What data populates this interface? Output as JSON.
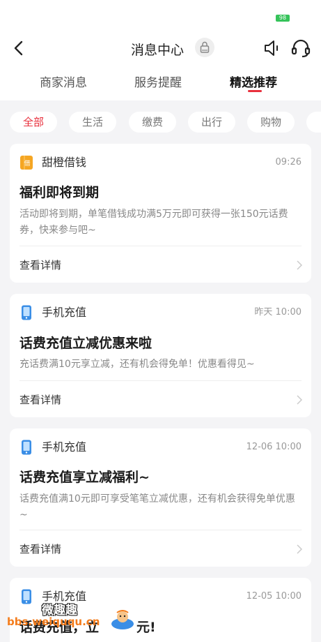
{
  "status_bar": {
    "battery": "98"
  },
  "header": {
    "title": "消息中心"
  },
  "tabs": [
    {
      "label": "商家消息"
    },
    {
      "label": "服务提醒"
    },
    {
      "label": "精选推荐"
    }
  ],
  "filters": [
    {
      "label": "全部"
    },
    {
      "label": "生活"
    },
    {
      "label": "缴费"
    },
    {
      "label": "出行"
    },
    {
      "label": "购物"
    }
  ],
  "messages": [
    {
      "source": "甜橙借钱",
      "icon_glyph": "借",
      "time": "09:26",
      "title": "福利即将到期",
      "body": "活动即将到期，单笔借钱成功满5万元即可获得一张150元话费券，快来参与吧~",
      "link": "查看详情"
    },
    {
      "source": "手机充值",
      "time": "昨天 10:00",
      "title": "话费充值立减优惠来啦",
      "body": "充话费满10元享立减，还有机会得免单！优惠看得见~",
      "link": "查看详情"
    },
    {
      "source": "手机充值",
      "time": "12-06 10:00",
      "title": "话费充值享立减福利~",
      "body": "话费充值满10元即可享受笔笔立减优惠，还有机会获得免单优惠~",
      "link": "查看详情"
    },
    {
      "source": "手机充值",
      "time": "12-05 10:00",
      "title": "话费充值，立",
      "title_tail": "元!"
    }
  ],
  "watermark": {
    "name": "微趣趣",
    "url": "bbs.weiququ.cn"
  },
  "colors": {
    "accent": "#e8303d",
    "orange_icon": "#f5a623",
    "phone_icon": "#3a8ee6"
  }
}
